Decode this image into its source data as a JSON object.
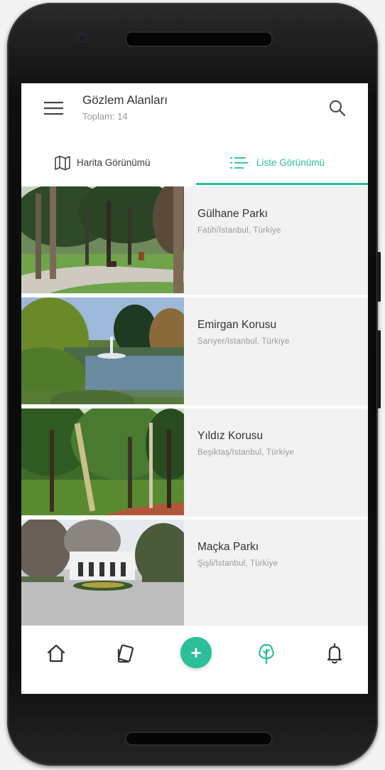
{
  "header": {
    "title": "Gözlem Alanları",
    "subtitle": "Toplam: 14"
  },
  "tabs": [
    {
      "label": "Harita Görünümü",
      "active": false
    },
    {
      "label": "Liste Görünümü",
      "active": true
    }
  ],
  "colors": {
    "accent": "#2bbf9a",
    "text_primary": "#333333",
    "text_secondary": "#9a9a9a",
    "row_background": "#f2f2f2"
  },
  "places": [
    {
      "name": "Gülhane Parkı",
      "location": "Fatih/Istanbul, Türkiye",
      "image": "park-path-photo"
    },
    {
      "name": "Emirgan Korusu",
      "location": "Sarıyer/Istanbul, Türkiye",
      "image": "pond-fountain-photo"
    },
    {
      "name": "Yıldız Korusu",
      "location": "Beşiktaş/Istanbul, Türkiye",
      "image": "forest-path-photo"
    },
    {
      "name": "Maçka Parkı",
      "location": "Şişli/Istanbul, Türkiye",
      "image": "plaza-gate-photo"
    }
  ],
  "bottom_nav": [
    {
      "icon": "home-icon"
    },
    {
      "icon": "cards-icon"
    },
    {
      "icon": "add-icon",
      "label": "+"
    },
    {
      "icon": "tree-icon",
      "active": true
    },
    {
      "icon": "bell-icon"
    }
  ]
}
